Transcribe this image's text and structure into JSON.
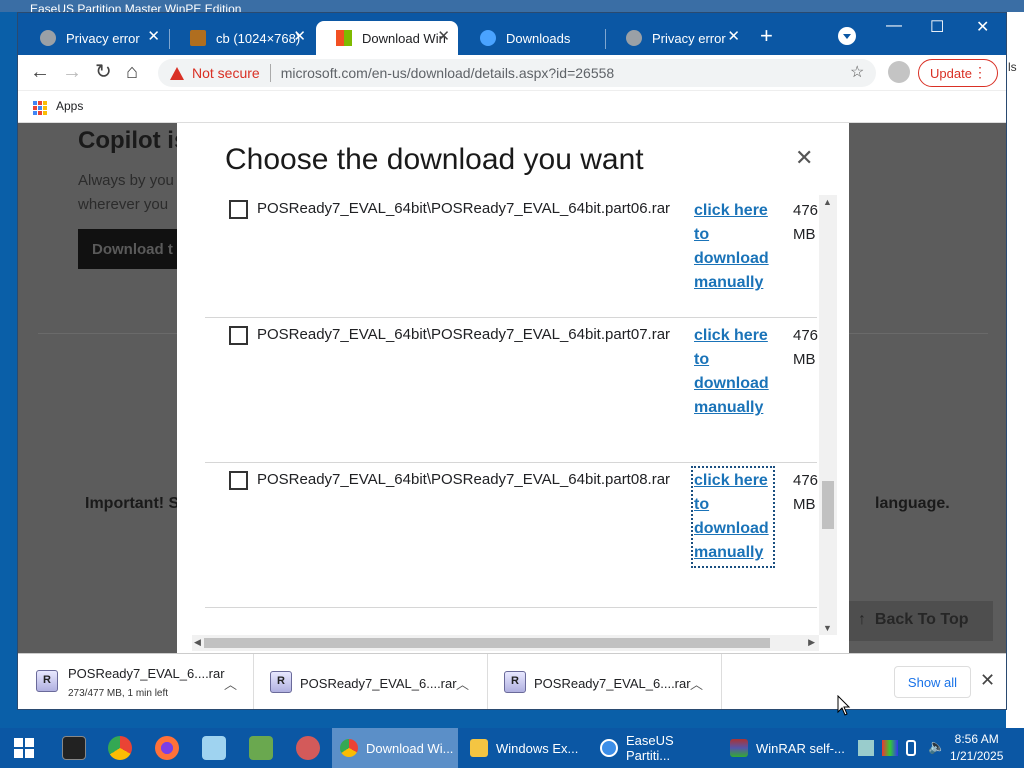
{
  "background_window_title": "EaseUS Partition Master WinPE Edition",
  "right_edge_text": "ls",
  "tabs": [
    {
      "label": "Privacy error",
      "active": false
    },
    {
      "label": "cb (1024×768)",
      "active": false
    },
    {
      "label": "Download Win",
      "active": true
    },
    {
      "label": "Downloads",
      "active": false
    },
    {
      "label": "Privacy error",
      "active": false
    }
  ],
  "toolbar": {
    "not_secure": "Not secure",
    "url": "microsoft.com/en-us/download/details.aspx?id=26558",
    "update_label": "Update"
  },
  "bookmarks": {
    "apps_label": "Apps"
  },
  "page_bg": {
    "heading": "Copilot is",
    "sub_line1": "Always by you",
    "sub_line2": "wherever you",
    "download_btn": "Download t",
    "important": "Important! S",
    "language": "language.",
    "back_to_top": "Back To Top"
  },
  "modal": {
    "title": "Choose the download you want",
    "close_glyph": "✕",
    "rows": [
      {
        "filename": "POSReady7_EVAL_64bit\\POSReady7_EVAL_64bit.part06.rar",
        "link": [
          "click here",
          "to",
          "download",
          "manually"
        ],
        "size": [
          "476",
          "MB"
        ],
        "focused": false
      },
      {
        "filename": "POSReady7_EVAL_64bit\\POSReady7_EVAL_64bit.part07.rar",
        "link": [
          "click here",
          "to",
          "download",
          "manually"
        ],
        "size": [
          "476",
          "MB"
        ],
        "focused": false
      },
      {
        "filename": "POSReady7_EVAL_64bit\\POSReady7_EVAL_64bit.part08.rar",
        "link": [
          "click here",
          "to",
          "download",
          "manually"
        ],
        "size": [
          "476",
          "MB"
        ],
        "focused": true
      }
    ]
  },
  "shelf": {
    "items": [
      {
        "name": "POSReady7_EVAL_6....rar",
        "status": "273/477 MB, 1 min left"
      },
      {
        "name": "POSReady7_EVAL_6....rar",
        "status": ""
      },
      {
        "name": "POSReady7_EVAL_6....rar",
        "status": ""
      }
    ],
    "show_all": "Show all"
  },
  "taskbar": {
    "items": [
      {
        "label": "Download Wi...",
        "active": true
      },
      {
        "label": "Windows Ex...",
        "active": false
      },
      {
        "label": "EaseUS Partiti...",
        "active": false
      },
      {
        "label": "WinRAR self-...",
        "active": false
      }
    ],
    "time": "8:56 AM",
    "date": "1/21/2025"
  },
  "colors": {
    "accent": "#0b57a4",
    "link": "#1a73b8",
    "warning": "#d93025"
  }
}
